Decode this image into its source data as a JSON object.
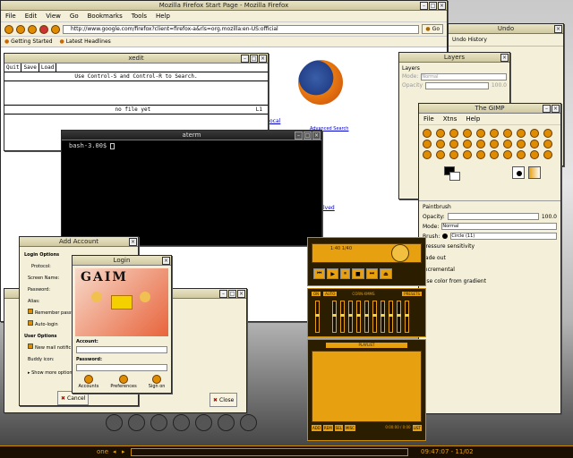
{
  "firefox": {
    "title": "Mozilla Firefox Start Page - Mozilla Firefox",
    "menu": [
      "File",
      "Edit",
      "View",
      "Go",
      "Bookmarks",
      "Tools",
      "Help"
    ],
    "url": "http://www.google.com/firefox?client=firefox-a&rls=org.mozilla:en-US:official",
    "go_label": "Go",
    "bookmarks": [
      "Getting Started",
      "Latest Headlines"
    ],
    "link_fragments": [
      "ocal",
      "Advanced Search",
      "lved"
    ]
  },
  "undo": {
    "title": "Undo",
    "list_label": "Undo History"
  },
  "layers": {
    "title": "Layers",
    "row_label": "Layers",
    "mode_label": "Mode:",
    "mode_value": "Normal",
    "opacity_label": "Opacity",
    "opacity_value": "100.0"
  },
  "gimp": {
    "title": "The GIMP",
    "menu": [
      "File",
      "Xtns",
      "Help"
    ],
    "tool_panel_title": "Paintbrush",
    "opacity_label": "Opacity:",
    "opacity_value": "100.0",
    "mode_label": "Mode:",
    "mode_value": "Normal",
    "brush_label": "Brush:",
    "brush_value": "Circle (11)",
    "options": [
      "Pressure sensitivity",
      "Fade out",
      "Incremental",
      "Use color from gradient"
    ]
  },
  "xedit": {
    "title": "xedit",
    "buttons": [
      "Quit",
      "Save",
      "Load"
    ],
    "hint": "Use Control-S and Control-R to Search.",
    "status": "no file yet",
    "line": "L1"
  },
  "aterm": {
    "title": "aterm",
    "prompt": "bash-3.00$ "
  },
  "add_account": {
    "title": "Add Account",
    "section_login": "Login Options",
    "protocol_label": "Protocol:",
    "screenname_label": "Screen Name:",
    "password_label": "Password:",
    "alias_label": "Alias:",
    "remember_label": "Remember passw",
    "autologin_label": "Auto-login",
    "section_user": "User Options",
    "newmail_label": "New mail notific",
    "buddyicon_label": "Buddy icon:",
    "more_label": "Show more options",
    "cancel_label": "Cancel",
    "close_label": "Close"
  },
  "gaim_login": {
    "title": "Login",
    "logo": "GAIM",
    "account_label": "Account:",
    "password_label": "Password:",
    "buttons": [
      "Accounts",
      "Preferences",
      "Sign on"
    ]
  },
  "xmms": {
    "time": "1:40 1/40",
    "eq_labels": [
      "ON",
      "AUTO"
    ],
    "presets_label": "PRESETS",
    "playlist_label": "PLAYLIST",
    "brand": "CORN-XMMS",
    "pl_buttons": [
      "ADD",
      "REM",
      "SEL",
      "MISC",
      "LIST"
    ],
    "pl_time": "0:00:00 / 0:00"
  },
  "taskbar": {
    "workspace": "one",
    "clock": "09:47:07 - 11/02"
  },
  "colors": {
    "accent": "#e6a010",
    "titlebar": "#d8d1ab",
    "window_bg": "#f3efd9"
  }
}
